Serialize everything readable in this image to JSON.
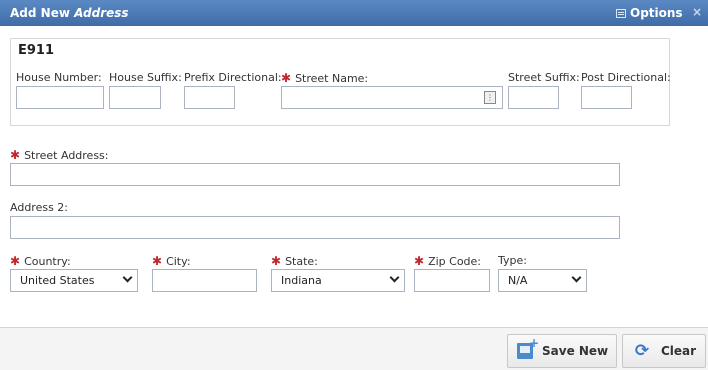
{
  "header": {
    "title_prefix": "Add New",
    "title_italic": "Address",
    "options_label": "Options",
    "close_glyph": "×"
  },
  "e911": {
    "legend": "E911",
    "house_number": {
      "label": "House Number:",
      "value": ""
    },
    "house_suffix": {
      "label": "House Suffix:",
      "value": ""
    },
    "prefix_directional": {
      "label": "Prefix Directional:",
      "value": ""
    },
    "street_name": {
      "label": "Street Name:",
      "value": "",
      "required": true
    },
    "street_suffix": {
      "label": "Street Suffix:",
      "value": ""
    },
    "post_directional": {
      "label": "Post Directional:",
      "value": ""
    }
  },
  "street_address": {
    "label": "Street Address:",
    "value": "",
    "required": true
  },
  "address2": {
    "label": "Address 2:",
    "value": ""
  },
  "country": {
    "label": "Country:",
    "value": "United States",
    "required": true
  },
  "city": {
    "label": "City:",
    "value": "",
    "required": true
  },
  "state": {
    "label": "State:",
    "value": "Indiana",
    "required": true
  },
  "zip": {
    "label": "Zip Code:",
    "value": "",
    "required": true
  },
  "type": {
    "label": "Type:",
    "value": "N/A"
  },
  "required_marker": "✱",
  "buttons": {
    "save_new": "Save New",
    "clear": "Clear"
  },
  "icons": {
    "options": "list-icon",
    "close": "close-icon",
    "lookup": "lookup-icon",
    "save": "save-new-icon",
    "clear": "refresh-icon"
  },
  "colors": {
    "header": "#4a78b5",
    "required": "#c0282e",
    "accent": "#3a78c5"
  }
}
